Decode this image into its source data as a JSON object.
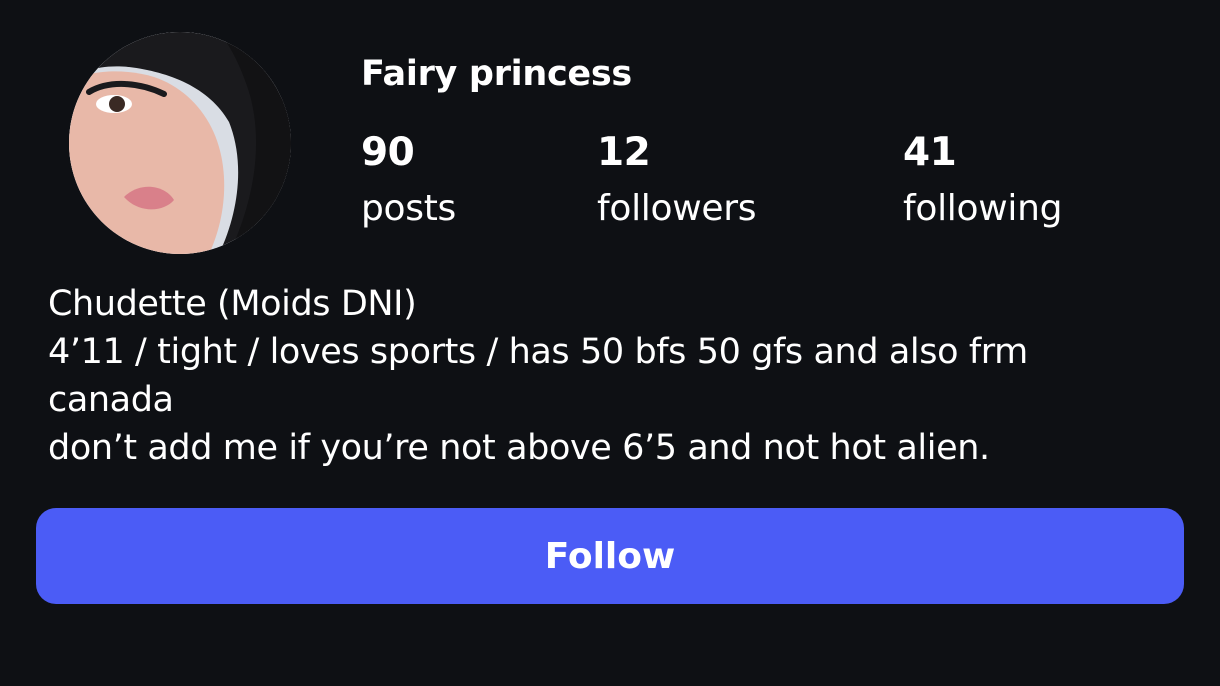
{
  "profile": {
    "display_name": "Fairy princess",
    "stats": {
      "posts_count": "90",
      "posts_label": "posts",
      "followers_count": "12",
      "followers_label": "followers",
      "following_count": "41",
      "following_label": "following"
    },
    "bio": {
      "line1": "Chudette (Moids DNI)",
      "line2": "4’11 / tight / loves sports / has 50 bfs 50 gfs and also frm",
      "line3": "canada",
      "line4": "don’t add me if you’re not above 6’5 and not hot alien."
    },
    "follow_label": "Follow",
    "colors": {
      "background": "#0e1014",
      "text": "#ffffff",
      "accent": "#4b5cf6"
    }
  }
}
